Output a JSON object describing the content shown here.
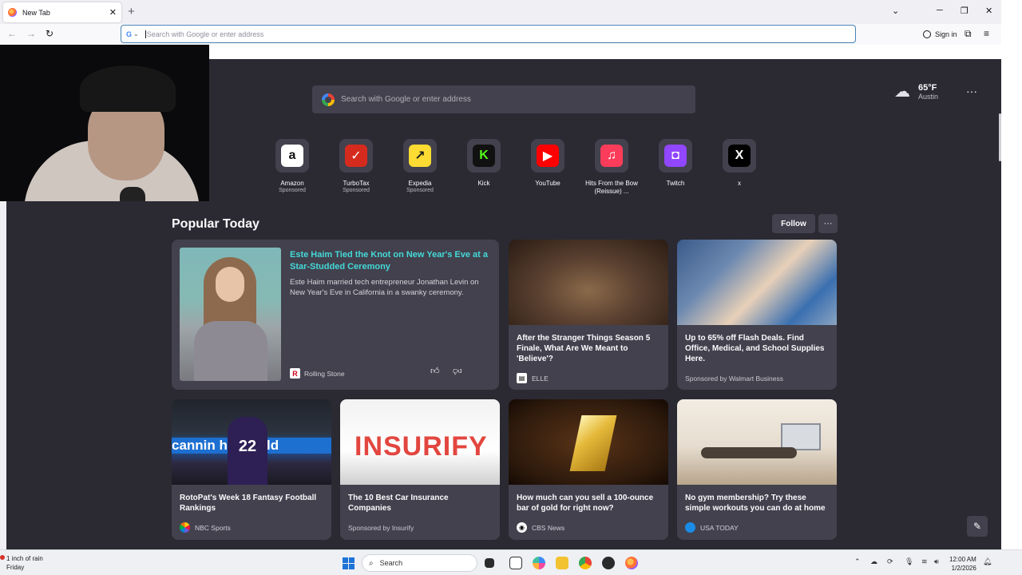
{
  "browser": {
    "tab_title": "New Tab",
    "tab_close_icon": "close-icon",
    "urlbar_engine": "G",
    "urlbar_placeholder": "Search with Google or enter address",
    "sign_in_label": "Sign in"
  },
  "newtab": {
    "search_placeholder": "Search with Google or enter address",
    "weather": {
      "temp": "65°F",
      "city": "Austin"
    },
    "shortcuts": [
      {
        "label": "Amazon",
        "sub": "Sponsored",
        "glyph": "a",
        "bg": "#ffffff",
        "fg": "#111111"
      },
      {
        "label": "TurboTax",
        "sub": "Sponsored",
        "glyph": "✓",
        "bg": "#d52b1e",
        "fg": "#ffffff"
      },
      {
        "label": "Expedia",
        "sub": "Sponsored",
        "glyph": "↗",
        "bg": "#fddb32",
        "fg": "#1a1a1a"
      },
      {
        "label": "Kick",
        "sub": "",
        "glyph": "K",
        "bg": "#111111",
        "fg": "#53fc18"
      },
      {
        "label": "YouTube",
        "sub": "",
        "glyph": "▶",
        "bg": "#ff0000",
        "fg": "#ffffff"
      },
      {
        "label": "Hits From the Bow (Reissue) ...",
        "sub": "",
        "glyph": "♫",
        "bg": "#fc3c5a",
        "fg": "#ffffff"
      },
      {
        "label": "Twitch",
        "sub": "",
        "glyph": "◘",
        "bg": "#9146ff",
        "fg": "#ffffff"
      },
      {
        "label": "x",
        "sub": "",
        "glyph": "X",
        "bg": "#000000",
        "fg": "#ffffff"
      }
    ],
    "popular_title": "Popular Today",
    "follow_label": "Follow",
    "feature": {
      "title": "Este Haim Tied the Knot on New Year's Eve at a Star-Studded Ceremony",
      "desc": "Este Haim married tech entrepreneur Jonathan Levin on New Year's Eve in California in a swanky ceremony.",
      "source": "Rolling Stone"
    },
    "cards": [
      {
        "title": "After the Stranger Things Season 5 Finale, What Are We Meant to 'Believe'?",
        "source": "ELLE",
        "sponsor": ""
      },
      {
        "title": "Up to 65% off Flash Deals. Find Office, Medical, and School Supplies Here.",
        "source": "",
        "sponsor": "Sponsored by Walmart Business"
      },
      {
        "title": "RotoPat's Week 18 Fantasy Football Rankings",
        "source": "NBC Sports",
        "sponsor": ""
      },
      {
        "title": "The 10 Best Car Insurance Companies",
        "source": "",
        "sponsor": "Sponsored by Insurify"
      },
      {
        "title": "How much can you sell a 100-ounce bar of gold for right now?",
        "source": "CBS News",
        "sponsor": ""
      },
      {
        "title": "No gym membership? Try these simple workouts you can do at home",
        "source": "USA TODAY",
        "sponsor": ""
      }
    ],
    "card_thumb_texts": {
      "insurify": "INSURIFY",
      "football_banner": "cannin  hole field",
      "jersey": "22"
    }
  },
  "taskbar": {
    "weather_line1": "1 inch of rain",
    "weather_line2": "Friday",
    "search_label": "Search",
    "time": "12:00 AM",
    "date": "1/2/2026"
  },
  "colors": {
    "page_bg": "#2b2a33",
    "card_bg": "#42414d",
    "accent_link": "#45d9d9",
    "urlbar_focus": "#4682b4"
  }
}
